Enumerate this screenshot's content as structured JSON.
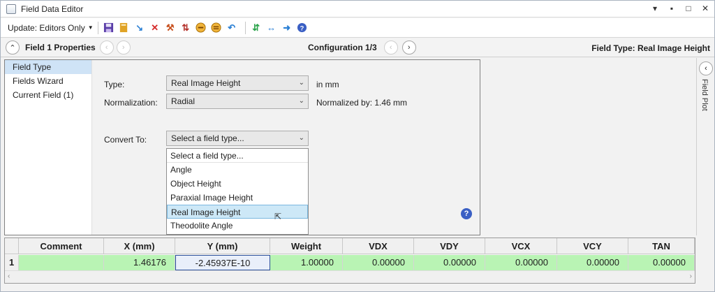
{
  "window": {
    "title": "Field Data Editor",
    "controls": {
      "dropdown": "▾",
      "pin": "▪",
      "restore": "□",
      "close": "✕"
    }
  },
  "toolbar": {
    "update_label": "Update: Editors Only",
    "icons": [
      "save-icon",
      "load-icon",
      "insert-arrow-icon",
      "delete-icon",
      "wizard-icon",
      "sort-icon",
      "minus-circle-icon",
      "minus-circle-alt-icon",
      "undo-arrow-icon",
      "swap-icon",
      "shift-icon",
      "arrow-right-icon",
      "help-icon"
    ]
  },
  "header": {
    "field_title": "Field  1 Properties",
    "config_title": "Configuration 1/3",
    "field_type_status": "Field Type: Real Image Height"
  },
  "nav": {
    "items": [
      {
        "label": "Field Type",
        "active": true
      },
      {
        "label": "Fields Wizard",
        "active": false
      },
      {
        "label": "Current Field (1)",
        "active": false
      }
    ]
  },
  "form": {
    "type_label": "Type:",
    "type_value": "Real Image Height",
    "type_unit": "in mm",
    "normalization_label": "Normalization:",
    "normalization_value": "Radial",
    "normalized_by": "Normalized by: 1.46 mm",
    "convert_label": "Convert To:",
    "convert_value": "Select a field type...",
    "convert_options": [
      "Select a field type...",
      "Angle",
      "Object Height",
      "Paraxial Image Height",
      "Real Image Height",
      "Theodolite Angle"
    ],
    "highlighted_option": "Real Image Height"
  },
  "side_panel": {
    "label": "Field Plot"
  },
  "grid": {
    "columns": [
      "Comment",
      "X (mm)",
      "Y (mm)",
      "Weight",
      "VDX",
      "VDY",
      "VCX",
      "VCY",
      "TAN"
    ],
    "rows": [
      {
        "index": "1",
        "cells": [
          "",
          "1.46176",
          "-2.45937E-10",
          "1.00000",
          "0.00000",
          "0.00000",
          "0.00000",
          "0.00000",
          "0.00000"
        ]
      }
    ]
  },
  "colors": {
    "row_fill": "#b9f4b4",
    "nav_active": "#cfe3f6",
    "help_blue": "#3a5fc4"
  }
}
